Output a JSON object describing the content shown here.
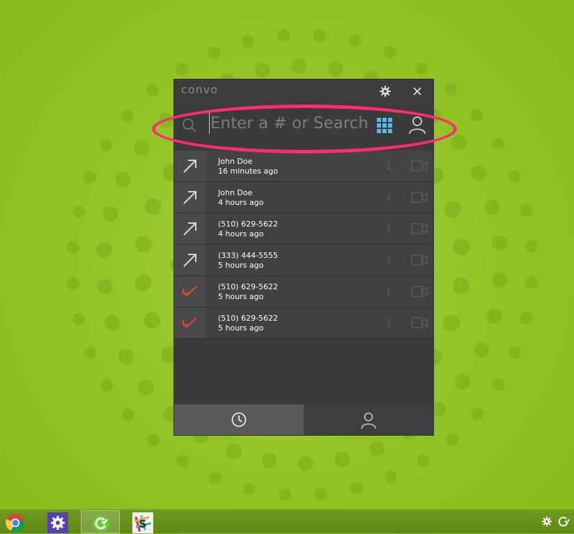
{
  "app": {
    "brand": "convo",
    "search": {
      "placeholder": "Enter a # or Search"
    }
  },
  "calls": [
    {
      "name": "John Doe",
      "time": "16 minutes ago",
      "direction": "outgoing"
    },
    {
      "name": "John Doe",
      "time": "4 hours ago",
      "direction": "outgoing"
    },
    {
      "name": "(510) 629-5622",
      "time": "4 hours ago",
      "direction": "outgoing"
    },
    {
      "name": "(333) 444-5555",
      "time": "5 hours ago",
      "direction": "outgoing"
    },
    {
      "name": "(510) 629-5622",
      "time": "5 hours ago",
      "direction": "missed"
    },
    {
      "name": "(510) 629-5622",
      "time": "5 hours ago",
      "direction": "missed"
    }
  ],
  "row_action_info": "i",
  "tabs": [
    "recent-calls",
    "contacts"
  ],
  "colors": {
    "background": "#8cbf1f",
    "window": "#3b3b3b",
    "accent_highlight": "#ff2d6e",
    "dialpad": "#5ab8ef",
    "missed_call": "#e0452e"
  },
  "taskbar": [
    "chrome",
    "settings",
    "convo",
    "slack"
  ],
  "icons": {
    "settings": "gear-icon",
    "close": "close-icon",
    "search": "search-icon",
    "dialpad": "dialpad-icon",
    "contact": "person-icon",
    "outgoing": "outgoing-call-icon",
    "missed": "missed-call-icon",
    "video": "video-icon",
    "history": "clock-icon"
  }
}
